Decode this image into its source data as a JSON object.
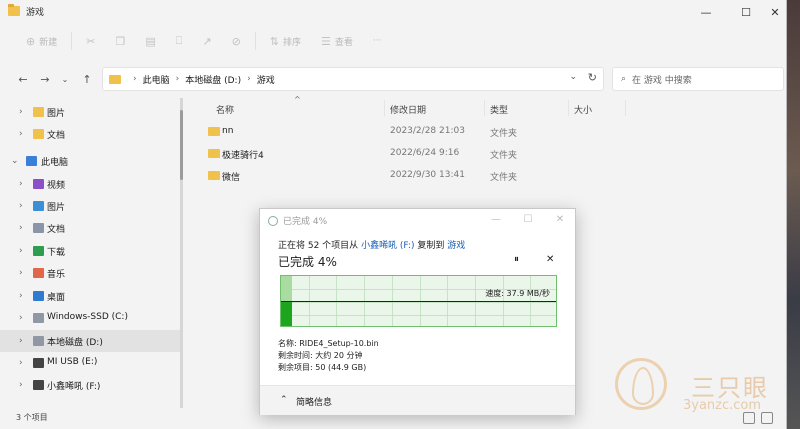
{
  "window": {
    "title": "游戏"
  },
  "command_bar": {
    "new_label": "新建",
    "sort_label": "排序",
    "view_label": "查看",
    "more_label": "···"
  },
  "address": {
    "crumbs": [
      "此电脑",
      "本地磁盘 (D:)",
      "游戏"
    ],
    "search_placeholder": "在 游戏 中搜索"
  },
  "nav_pane": {
    "items": [
      {
        "label": "图片",
        "icon": "pictures-folder-icon",
        "color": "#f0c14b",
        "indent": 0,
        "chevron": "›"
      },
      {
        "label": "文档",
        "icon": "documents-folder-icon",
        "color": "#f0c14b",
        "indent": 0,
        "chevron": "›"
      },
      {
        "label": "此电脑",
        "icon": "computer-icon",
        "color": "#3c7fd9",
        "indent": -1,
        "chevron": "⌄"
      },
      {
        "label": "视频",
        "icon": "videos-icon",
        "color": "#8a4fc9",
        "indent": 0,
        "chevron": "›"
      },
      {
        "label": "图片",
        "icon": "pictures-icon",
        "color": "#3b8fd6",
        "indent": 0,
        "chevron": "›"
      },
      {
        "label": "文档",
        "icon": "documents-icon",
        "color": "#8a96a8",
        "indent": 0,
        "chevron": "›"
      },
      {
        "label": "下载",
        "icon": "downloads-icon",
        "color": "#2d9d4f",
        "indent": 0,
        "chevron": "›"
      },
      {
        "label": "音乐",
        "icon": "music-icon",
        "color": "#e2674a",
        "indent": 0,
        "chevron": "›"
      },
      {
        "label": "桌面",
        "icon": "desktop-icon",
        "color": "#2f7bd0",
        "indent": 0,
        "chevron": "›"
      },
      {
        "label": "Windows-SSD (C:)",
        "icon": "drive-c-icon",
        "color": "#8f98a4",
        "indent": 0,
        "chevron": "›"
      },
      {
        "label": "本地磁盘 (D:)",
        "icon": "drive-d-icon",
        "color": "#8f98a4",
        "indent": 0,
        "chevron": "›",
        "selected": true
      },
      {
        "label": "MI USB (E:)",
        "icon": "usb-drive-icon",
        "color": "#444444",
        "indent": 0,
        "chevron": "›"
      },
      {
        "label": "小鑫唏吼 (F:)",
        "icon": "usb-drive-icon",
        "color": "#444444",
        "indent": 0,
        "chevron": "›"
      }
    ]
  },
  "columns": {
    "name": "名称",
    "modified": "修改日期",
    "type": "类型",
    "size": "大小"
  },
  "files": [
    {
      "name": "nn",
      "date": "2023/2/28 21:03",
      "type": "文件夹"
    },
    {
      "name": "极速骑行4",
      "date": "2022/6/24 9:16",
      "type": "文件夹"
    },
    {
      "name": "微信",
      "date": "2022/9/30 13:41",
      "type": "文件夹"
    }
  ],
  "status": {
    "count": "3 个项目"
  },
  "copy_dialog": {
    "title": "已完成 4%",
    "line_prefix": "正在将 52 个项目从",
    "source": "小鑫唏吼 (F:)",
    "line_mid": "复制到",
    "destination": "游戏",
    "percent_text": "已完成 4%",
    "progress": 0.04,
    "speed_text": "速度: 37.9 MB/秒",
    "name_text": "名称: RIDE4_Setup-10.bin",
    "time_text": "剩余时间: 大约 20 分钟",
    "items_text": "剩余项目: 50 (44.9 GB)",
    "details_label": "简略信息",
    "pause_icon": "pause-icon",
    "cancel_icon": "close-icon"
  },
  "watermark": {
    "text": "三只眼",
    "url": "3yanzc.com"
  }
}
